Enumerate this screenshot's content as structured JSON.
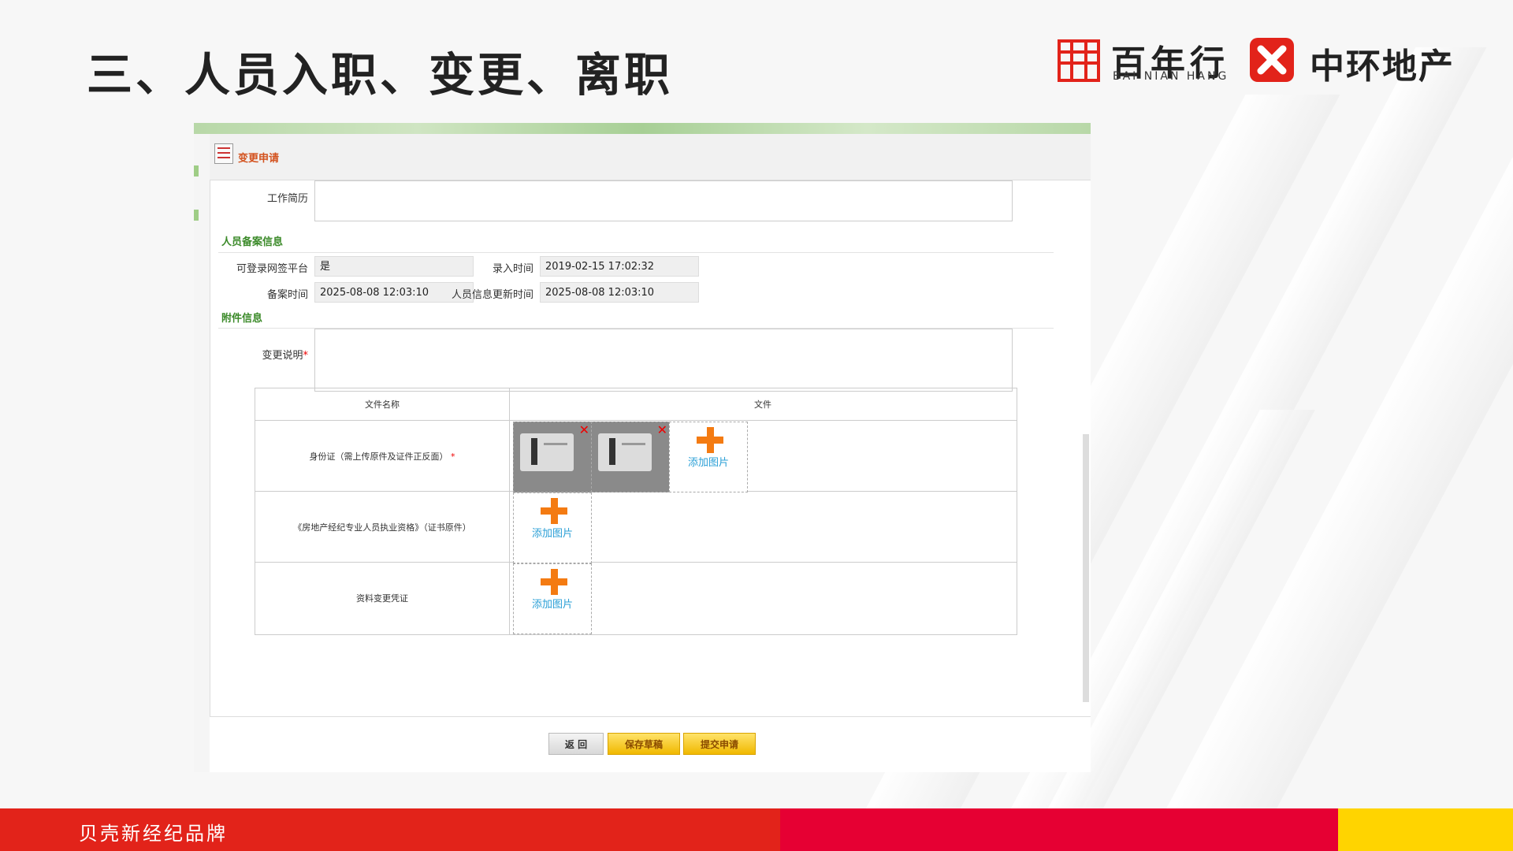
{
  "slide": {
    "title": "三、人员入职、变更、离职",
    "logo1_name": "百年行",
    "logo1_sub": "BAI NIAN HANG",
    "logo2_name": "中环地产",
    "footer_text": "贝壳新经纪品牌"
  },
  "colors": {
    "footer_red": "#e2231a",
    "footer_crimson": "#e60033",
    "footer_yellow": "#ffd400",
    "section_green": "#3b8a29",
    "window_title": "#d3521e"
  },
  "window": {
    "title": "变更申请"
  },
  "form": {
    "work_history_label": "工作简历",
    "section_record": "人员备案信息",
    "can_login_label": "可登录网签平台",
    "can_login_value": "是",
    "entry_time_label": "录入时间",
    "entry_time_value": "2019-02-15 17:02:32",
    "record_time_label": "备案时间",
    "record_time_value": "2025-08-08 12:03:10",
    "update_time_label": "人员信息更新时间",
    "update_time_value": "2025-08-08 12:03:10",
    "section_attach": "附件信息",
    "change_desc_label": "变更说明",
    "required_mark": "*"
  },
  "files": {
    "col_name": "文件名称",
    "col_file": "文件",
    "rows": [
      {
        "name": "身份证（需上传原件及证件正反面）",
        "required": true
      },
      {
        "name": "《房地产经纪专业人员执业资格》（证书原件）",
        "required": false
      },
      {
        "name": "资料变更凭证",
        "required": false
      }
    ],
    "add_label": "添加图片",
    "delete_glyph": "✕"
  },
  "buttons": {
    "back": "返 回",
    "save_draft": "保存草稿",
    "submit": "提交申请"
  }
}
